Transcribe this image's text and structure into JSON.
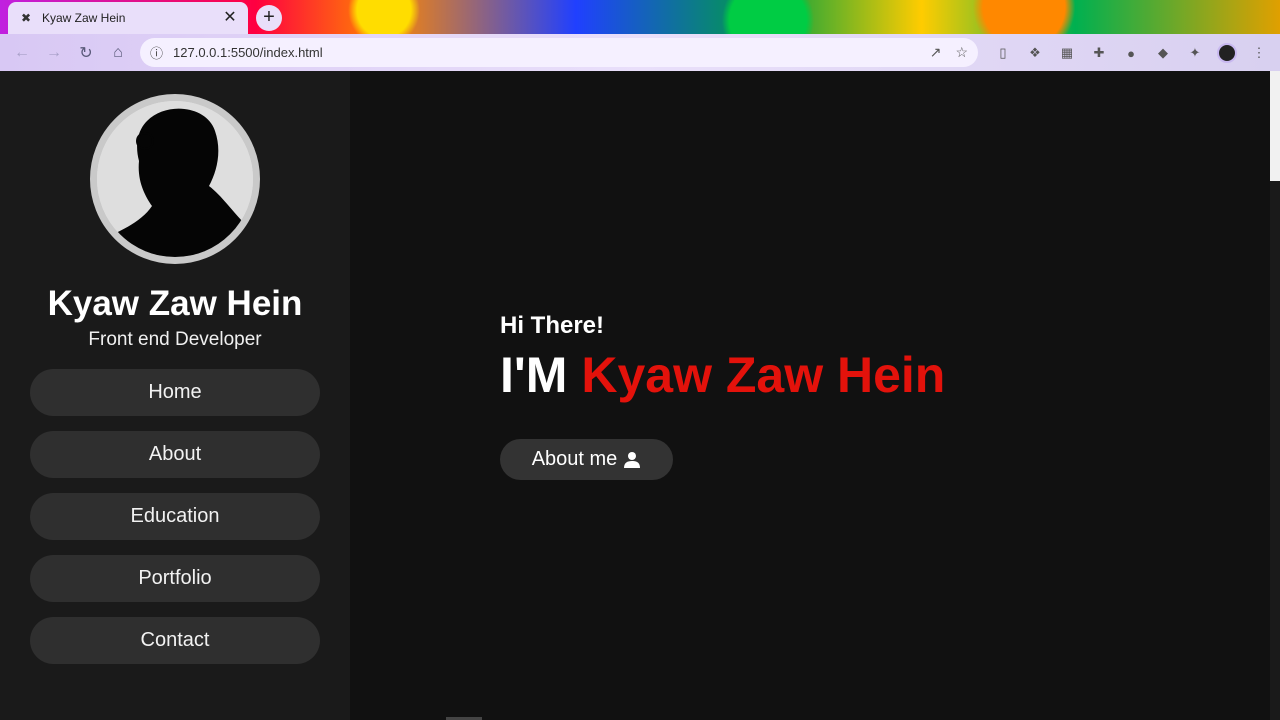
{
  "browser": {
    "tab_title": "Kyaw Zaw Hein",
    "url": "127.0.0.1:5500/index.html",
    "new_tab_label": "+",
    "tab_close_label": "✕",
    "favicon_label": "✖"
  },
  "sidebar": {
    "name": "Kyaw Zaw Hein",
    "role": "Front end Developer",
    "items": [
      {
        "label": "Home"
      },
      {
        "label": "About"
      },
      {
        "label": "Education"
      },
      {
        "label": "Portfolio"
      },
      {
        "label": "Contact"
      }
    ]
  },
  "hero": {
    "greeting": "Hi There!",
    "prefix": "I'M",
    "name": "Kyaw Zaw Hein",
    "button_label": "About me"
  },
  "colors": {
    "accent": "#e3120b",
    "sidebar_bg": "#1a1a1a",
    "main_bg": "#111111",
    "button_bg": "#2f2f2f"
  },
  "icons": [
    "back-icon",
    "forward-icon",
    "reload-icon",
    "home-icon",
    "info-icon",
    "share-icon",
    "star-icon",
    "user-icon"
  ]
}
